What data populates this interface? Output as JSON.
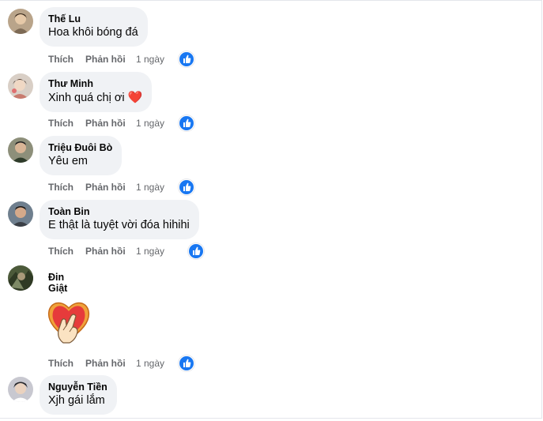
{
  "comments": [
    {
      "author": "Thế Lu",
      "text": "Hoa khôi bóng đá",
      "like": "Thích",
      "reply": "Phản hồi",
      "time": "1 ngày"
    },
    {
      "author": "Thư Minh",
      "text": "Xinh quá chị ơi",
      "emoji": "❤️",
      "like": "Thích",
      "reply": "Phản hồi",
      "time": "1 ngày"
    },
    {
      "author": "Triệu Đuôi Bò",
      "text": "Yêu em",
      "like": "Thích",
      "reply": "Phản hồi",
      "time": "1 ngày"
    },
    {
      "author": "Toàn Bin",
      "text": "E thật là tuyệt vời đóa hihihi",
      "like": "Thích",
      "reply": "Phản hồi",
      "time": "1 ngày"
    },
    {
      "author": "Đin Giật",
      "sticker": "heart-hand-sticker",
      "like": "Thích",
      "reply": "Phản hồi",
      "time": "1 ngày"
    },
    {
      "author": "Nguyễn Tiền",
      "text": "Xjh gái lắm"
    }
  ],
  "reaction_icon": "like-thumb-icon",
  "colors": {
    "bubble": "#f0f2f5",
    "meta": "#65676b",
    "like_blue": "#1877f2",
    "heart": "#e41e3f"
  }
}
